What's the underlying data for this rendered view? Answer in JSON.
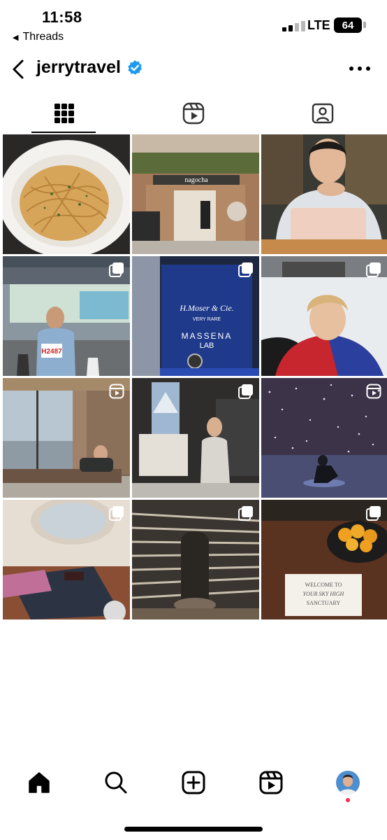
{
  "status_bar": {
    "time": "11:58",
    "back_app": "Threads",
    "network": "LTE",
    "battery": "64"
  },
  "header": {
    "username": "jerrytravel"
  },
  "tabs": [
    {
      "icon": "grid-icon",
      "active": true
    },
    {
      "icon": "reels-icon",
      "active": false
    },
    {
      "icon": "tagged-icon",
      "active": false
    }
  ],
  "posts": [
    {
      "subject": "spaghetti",
      "badge": null,
      "sign": ""
    },
    {
      "subject": "nagocha-storefront",
      "badge": null,
      "sign": "nagocha"
    },
    {
      "subject": "man-with-laptop",
      "badge": null,
      "sign": ""
    },
    {
      "subject": "marathon-runner",
      "badge": "carousel",
      "sign": "H2487"
    },
    {
      "subject": "watch-display",
      "badge": "carousel",
      "sign": "H.Moser & Cie."
    },
    {
      "subject": "ski-selfie",
      "badge": "carousel",
      "sign": ""
    },
    {
      "subject": "hotel-room",
      "badge": "reel",
      "sign": ""
    },
    {
      "subject": "outdoor-store",
      "badge": "carousel",
      "sign": ""
    },
    {
      "subject": "light-installation",
      "badge": "reel",
      "sign": ""
    },
    {
      "subject": "airplane-menu",
      "badge": "carousel",
      "sign": ""
    },
    {
      "subject": "wine-cellar",
      "badge": "carousel",
      "sign": ""
    },
    {
      "subject": "welcome-card",
      "badge": "carousel",
      "sign": ""
    }
  ],
  "watch_card": {
    "brand": "H.Moser & Cie.",
    "tagline": "VERY RARE",
    "title": "MASSENA",
    "subtitle": "LAB"
  },
  "welcome_card": {
    "line1": "WELCOME TO",
    "line2": "YOUR SKY HIGH",
    "line3": "SANCTUARY"
  },
  "bottom_nav": [
    {
      "icon": "home-icon"
    },
    {
      "icon": "search-icon"
    },
    {
      "icon": "create-icon"
    },
    {
      "icon": "reels-icon"
    },
    {
      "icon": "profile-avatar"
    }
  ],
  "colors": {
    "verified": "#1d9bf0",
    "notification_dot": "#ff2a4a"
  }
}
